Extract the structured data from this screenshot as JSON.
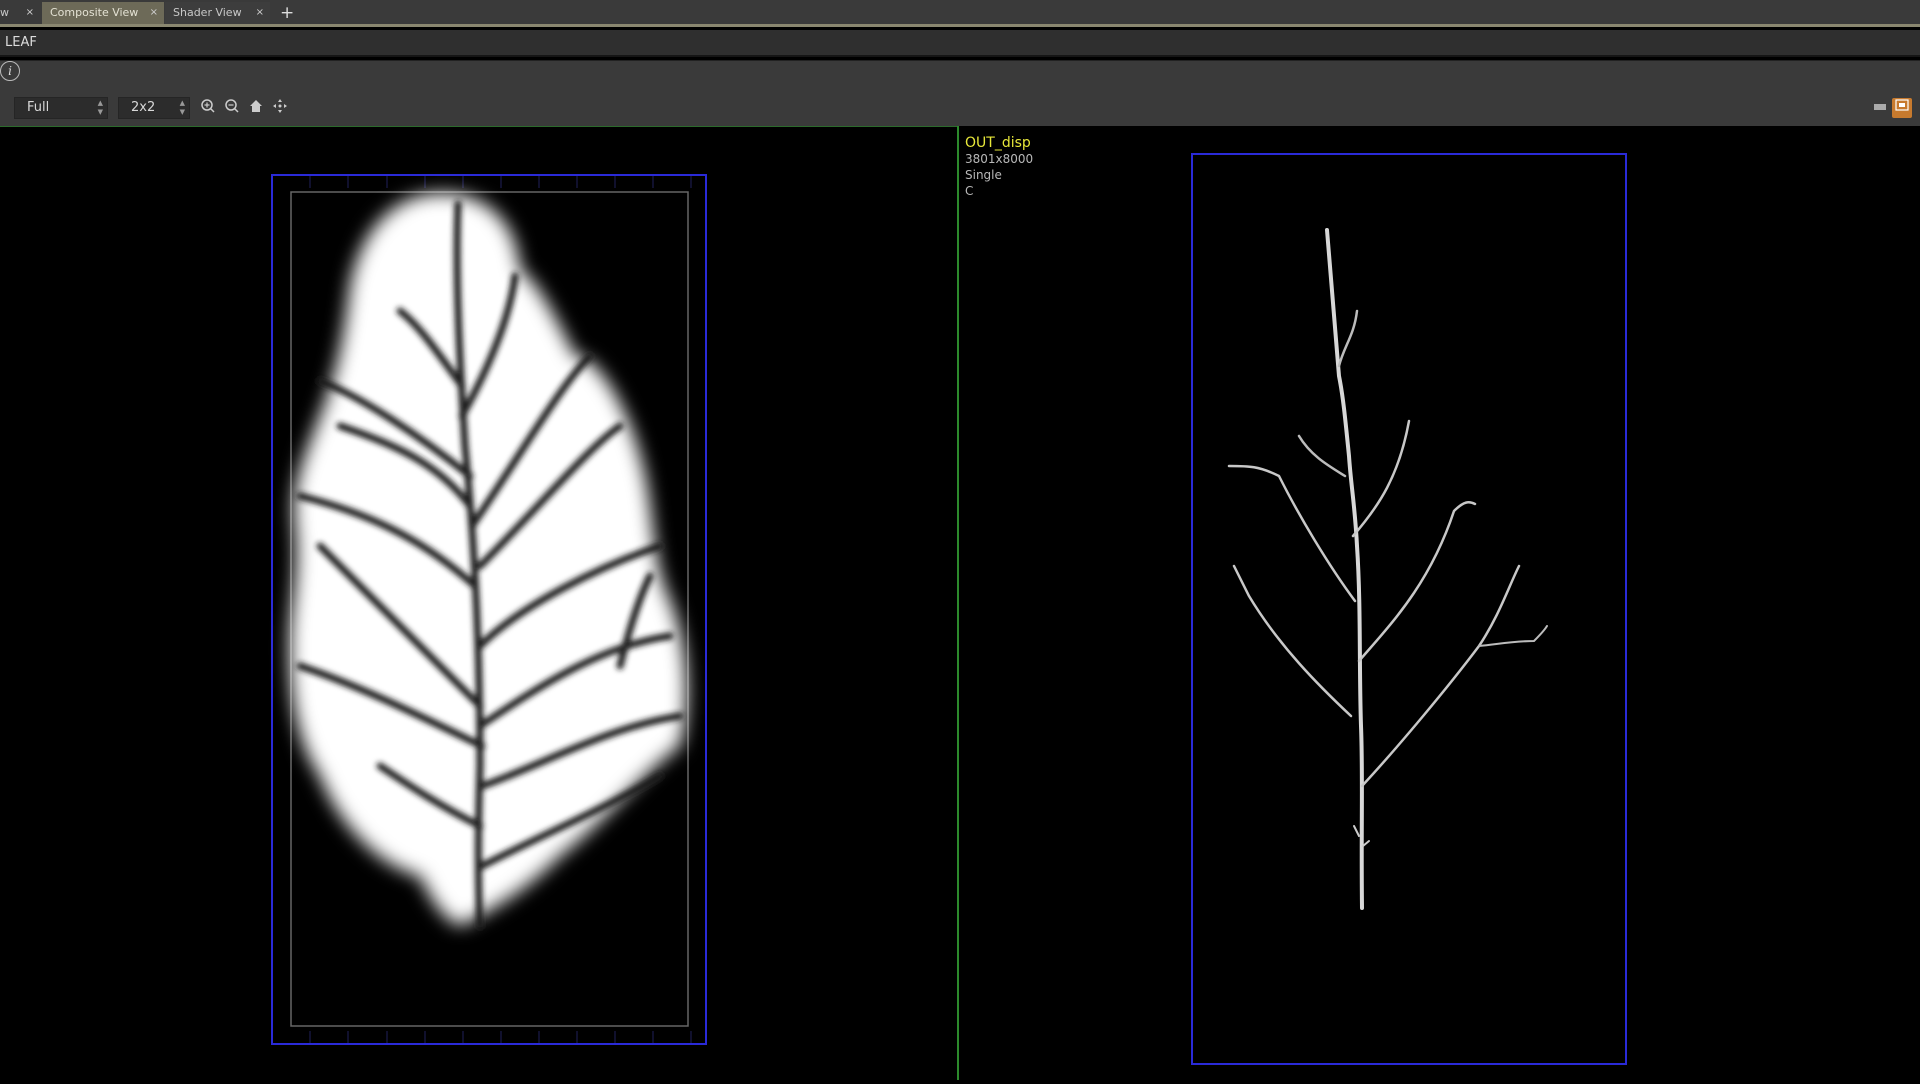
{
  "tabs": {
    "partial_label": "w",
    "items": [
      {
        "label": "Composite View",
        "active": true
      },
      {
        "label": "Shader View",
        "active": false
      }
    ],
    "close_glyph": "×",
    "add_glyph": "+"
  },
  "path": {
    "label": "LEAF"
  },
  "toolbar": {
    "resolution_value": "Full",
    "grid_value": "2x2",
    "info_glyph": "i",
    "icons": [
      "zoom-in-icon",
      "zoom-out-icon",
      "home-icon",
      "fit-icon",
      "info-icon",
      "single-view-icon",
      "split-view-icon"
    ]
  },
  "viewer_right": {
    "node_name": "OUT_disp",
    "resolution": "3801x8000",
    "mode": "Single",
    "channel": "C"
  },
  "colors": {
    "active_tab": "#6d6a58",
    "viewport_divider": "#2c8a2c",
    "image_border": "#2a2ad8",
    "node_name": "#e8e83a",
    "toggle_active": "#c77a2e"
  }
}
